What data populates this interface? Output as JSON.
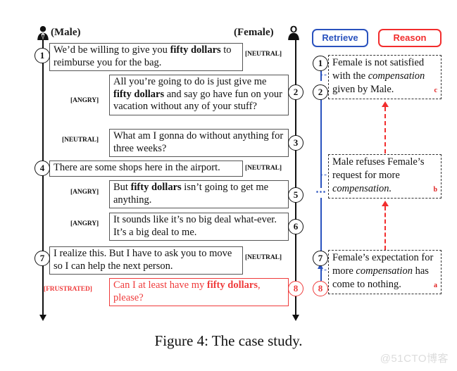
{
  "figure": {
    "caption": "Figure 4: The case study.",
    "watermark": "@51CTO博客"
  },
  "speakers": {
    "male": {
      "label": "(Male)",
      "icon": "male-person-icon"
    },
    "female": {
      "label": "(Female)",
      "icon": "female-person-icon"
    }
  },
  "legend": {
    "retrieve": {
      "label": "Retrieve",
      "color": "#2a52be"
    },
    "reason": {
      "label": "Reason",
      "color": "#f22d2d"
    }
  },
  "dialogue": [
    {
      "turn": "1",
      "speaker": "male",
      "emotion": "[NEUTRAL]",
      "text_parts": [
        {
          "t": "We’d be willing to give you ",
          "b": false
        },
        {
          "t": "fifty dollars",
          "b": true
        },
        {
          "t": " to reimburse you for the bag.",
          "b": false
        }
      ],
      "highlight": false
    },
    {
      "turn": "2",
      "speaker": "female",
      "emotion": "[ANGRY]",
      "text_parts": [
        {
          "t": "All you’re going to do is just give me ",
          "b": false
        },
        {
          "t": "fifty dollars",
          "b": true
        },
        {
          "t": " and say go have fun on your vacation without any of your stuff?",
          "b": false
        }
      ],
      "highlight": false
    },
    {
      "turn": "3",
      "speaker": "female",
      "emotion": "[NEUTRAL]",
      "text_parts": [
        {
          "t": "What am I gonna do without anything for three weeks?",
          "b": false
        }
      ],
      "highlight": false
    },
    {
      "turn": "4",
      "speaker": "male",
      "emotion": "[NEUTRAL]",
      "text_parts": [
        {
          "t": "There are some shops here in the airport.",
          "b": false
        }
      ],
      "highlight": false
    },
    {
      "turn": "5",
      "speaker": "female",
      "emotion": "[ANGRY]",
      "text_parts": [
        {
          "t": "But ",
          "b": false
        },
        {
          "t": "fifty dollars",
          "b": true
        },
        {
          "t": " isn’t going to get me anything.",
          "b": false
        }
      ],
      "highlight": false
    },
    {
      "turn": "6",
      "speaker": "female",
      "emotion": "[ANGRY]",
      "text_parts": [
        {
          "t": "It sounds like it’s no big deal what-ever. It’s a big deal to me.",
          "b": false
        }
      ],
      "highlight": false
    },
    {
      "turn": "7",
      "speaker": "male",
      "emotion": "[NEUTRAL]",
      "text_parts": [
        {
          "t": "I realize this. But I have to ask you to move so I can help the next person.",
          "b": false
        }
      ],
      "highlight": false
    },
    {
      "turn": "8",
      "speaker": "female",
      "emotion": "[FRUSTRATED]",
      "text_parts": [
        {
          "t": "Can I at least have my ",
          "b": false
        },
        {
          "t": "fifty dollars",
          "b": true
        },
        {
          "t": ", please?",
          "b": false
        }
      ],
      "highlight": true
    }
  ],
  "retrieve_markers": [
    {
      "turn": "1",
      "highlight": false
    },
    {
      "turn": "2",
      "highlight": false
    },
    {
      "turn": "7",
      "highlight": false
    },
    {
      "turn": "8",
      "highlight": true
    }
  ],
  "reason_boxes": [
    {
      "tag": "c",
      "parts": [
        {
          "t": "Female is not satisfied with the ",
          "i": false
        },
        {
          "t": "compensation",
          "i": true
        },
        {
          "t": " given by Male.",
          "i": false
        }
      ]
    },
    {
      "tag": "b",
      "parts": [
        {
          "t": "Male refuses Female’s request for more ",
          "i": false
        },
        {
          "t": "compensation.",
          "i": true
        }
      ]
    },
    {
      "tag": "a",
      "parts": [
        {
          "t": "Female’s expectation for more ",
          "i": false
        },
        {
          "t": "compensation",
          "i": true
        },
        {
          "t": " has come to nothing.",
          "i": false
        }
      ]
    }
  ],
  "ellipsis": "⋯"
}
